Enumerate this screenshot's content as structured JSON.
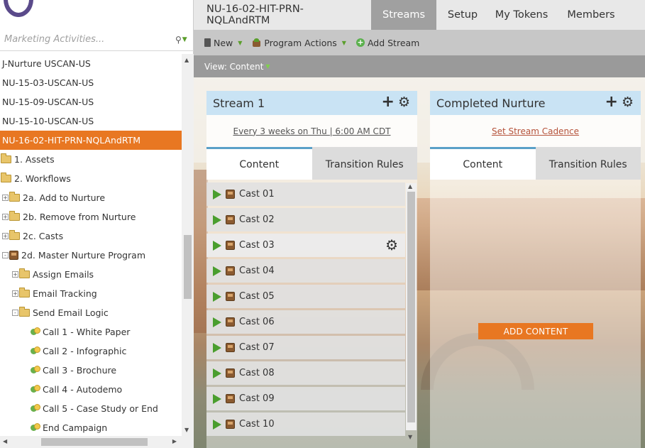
{
  "search": {
    "placeholder": "Marketing Activities..."
  },
  "tree": [
    {
      "label": "J-Nurture USCAN-US",
      "type": "none",
      "indent": 0,
      "expander": ""
    },
    {
      "label": "NU-15-03-USCAN-US",
      "type": "none",
      "indent": 0,
      "expander": ""
    },
    {
      "label": "NU-15-09-USCAN-US",
      "type": "none",
      "indent": 0,
      "expander": ""
    },
    {
      "label": "NU-15-10-USCAN-US",
      "type": "none",
      "indent": 0,
      "expander": ""
    },
    {
      "label": "NU-16-02-HIT-PRN-NQLAndRTM",
      "type": "none",
      "indent": 0,
      "expander": "",
      "selected": true
    },
    {
      "label": "1. Assets",
      "type": "folder",
      "indent": 0,
      "expander": ""
    },
    {
      "label": "2. Workflows",
      "type": "folder",
      "indent": 0,
      "expander": ""
    },
    {
      "label": "2a. Add to Nurture",
      "type": "folder",
      "indent": 0,
      "expander": "+"
    },
    {
      "label": "2b. Remove from Nurture",
      "type": "folder",
      "indent": 0,
      "expander": "+"
    },
    {
      "label": "2c. Casts",
      "type": "folder",
      "indent": 0,
      "expander": "+"
    },
    {
      "label": "2d. Master Nurture Program",
      "type": "program",
      "indent": 0,
      "expander": "-"
    },
    {
      "label": "Assign Emails",
      "type": "folder",
      "indent": 1,
      "expander": "+"
    },
    {
      "label": "Email Tracking",
      "type": "folder",
      "indent": 1,
      "expander": "+"
    },
    {
      "label": "Send Email Logic",
      "type": "folder",
      "indent": 1,
      "expander": "-"
    },
    {
      "label": "Call 1 - White Paper",
      "type": "campaign",
      "indent": 2,
      "expander": ""
    },
    {
      "label": "Call 2 - Infographic",
      "type": "campaign",
      "indent": 2,
      "expander": ""
    },
    {
      "label": "Call 3 - Brochure",
      "type": "campaign",
      "indent": 2,
      "expander": ""
    },
    {
      "label": "Call 4 - Autodemo",
      "type": "campaign",
      "indent": 2,
      "expander": ""
    },
    {
      "label": "Call 5 - Case Study or End",
      "type": "campaign",
      "indent": 2,
      "expander": ""
    },
    {
      "label": "End Campaign",
      "type": "campaign",
      "indent": 2,
      "expander": ""
    }
  ],
  "nav": {
    "program": "NU-16-02-HIT-PRN-NQLAndRTM",
    "streams": "Streams",
    "setup": "Setup",
    "tokens": "My Tokens",
    "members": "Members"
  },
  "toolbar": {
    "new": "New",
    "program_actions": "Program Actions",
    "add_stream": "Add Stream"
  },
  "view": {
    "label": "View: Content"
  },
  "streams": [
    {
      "title": "Stream 1",
      "cadence": "Every 3 weeks on Thu | 6:00 AM CDT",
      "tab_content": "Content",
      "tab_rules": "Transition Rules",
      "casts": [
        "Cast 01",
        "Cast 02",
        "Cast 03",
        "Cast 04",
        "Cast 05",
        "Cast 06",
        "Cast 07",
        "Cast 08",
        "Cast 09",
        "Cast 10"
      ]
    },
    {
      "title": "Completed Nurture",
      "cadence": "Set Stream Cadence",
      "tab_content": "Content",
      "tab_rules": "Transition Rules",
      "add_content": "ADD CONTENT"
    }
  ],
  "colors": {
    "accent_orange": "#e87722",
    "stream_header": "#c9e3f4",
    "active_tab_border": "#5aa0c8"
  }
}
